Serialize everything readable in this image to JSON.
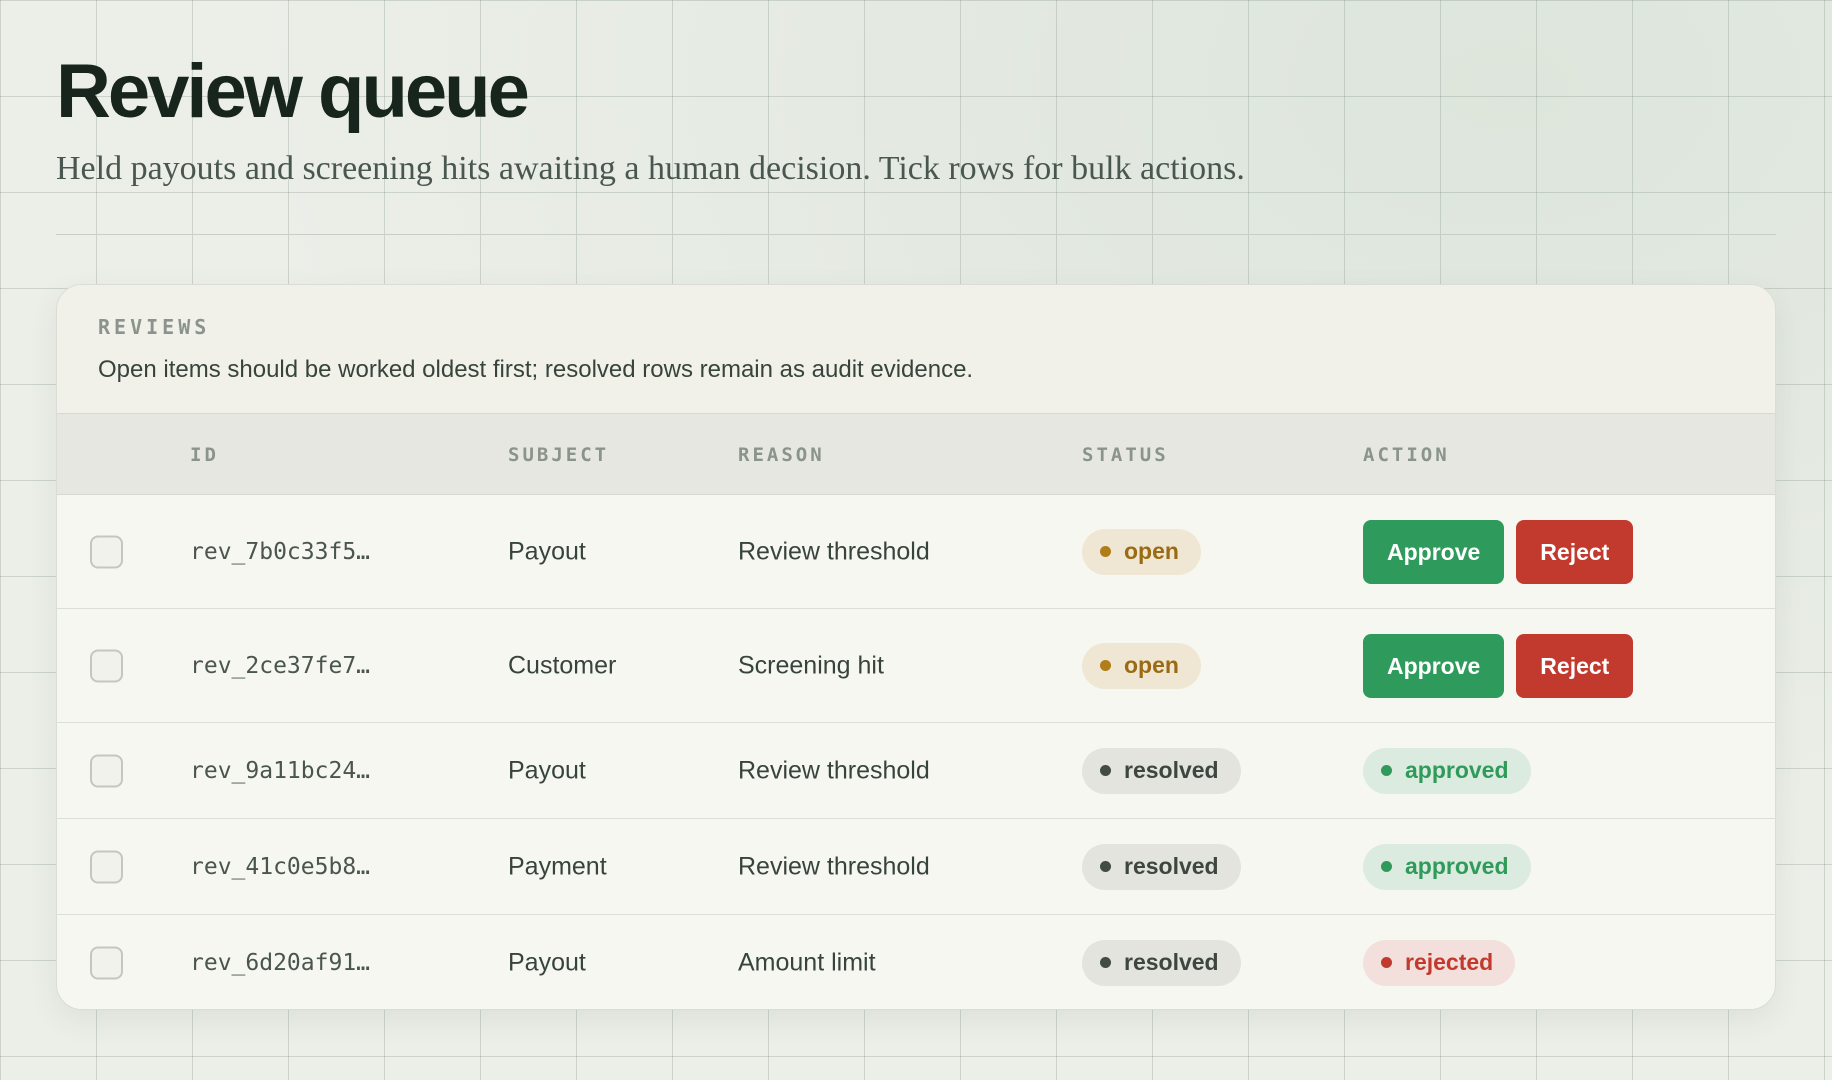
{
  "page": {
    "title": "Review queue",
    "subtitle": "Held payouts and screening hits awaiting a human decision. Tick rows for bulk actions."
  },
  "card": {
    "eyebrow": "REVIEWS",
    "description": "Open items should be worked oldest first; resolved rows remain as audit evidence."
  },
  "table": {
    "columns": [
      "ID",
      "SUBJECT",
      "REASON",
      "STATUS",
      "ACTION"
    ],
    "rows": [
      {
        "id": "rev_7b0c33f5…",
        "subject": "Payout",
        "reason": "Review threshold",
        "status": "open",
        "action": {
          "approve": "Approve",
          "reject": "Reject"
        }
      },
      {
        "id": "rev_2ce37fe7…",
        "subject": "Customer",
        "reason": "Screening hit",
        "status": "open",
        "action": {
          "approve": "Approve",
          "reject": "Reject"
        }
      },
      {
        "id": "rev_9a11bc24…",
        "subject": "Payout",
        "reason": "Review threshold",
        "status": "resolved",
        "outcome": "approved"
      },
      {
        "id": "rev_41c0e5b8…",
        "subject": "Payment",
        "reason": "Review threshold",
        "status": "resolved",
        "outcome": "approved"
      },
      {
        "id": "rev_6d20af91…",
        "subject": "Payout",
        "reason": "Amount limit",
        "status": "resolved",
        "outcome": "rejected"
      }
    ]
  },
  "colors": {
    "approve": "#2e9b5c",
    "reject": "#c23a2e",
    "open": "#9a6b12",
    "resolved": "#3d4740",
    "approved": "#2f9a5a",
    "rejected": "#c23a2e"
  },
  "icons": {
    "status_dot": "dot-icon",
    "row_select": "checkbox"
  }
}
